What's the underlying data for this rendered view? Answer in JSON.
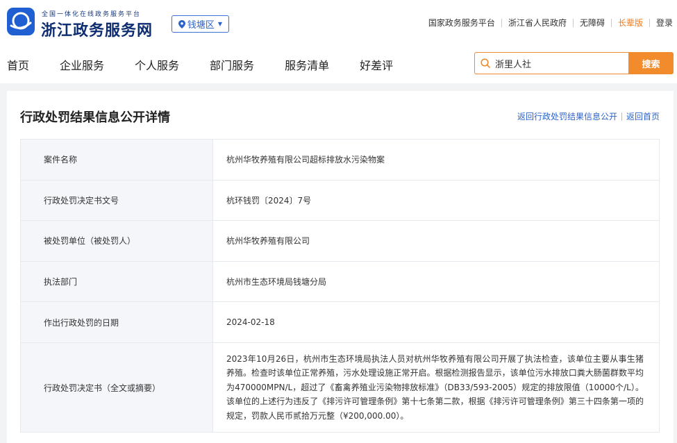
{
  "header": {
    "logo_tagline": "全国一体化在线政务服务平台",
    "logo_title": "浙江政务服务网",
    "region": "钱塘区",
    "top_links": [
      "国家政务服务平台",
      "浙江省人民政府",
      "无障碍",
      "长辈版",
      "登录"
    ]
  },
  "nav": {
    "items": [
      "首页",
      "企业服务",
      "个人服务",
      "部门服务",
      "服务清单",
      "好差评"
    ]
  },
  "search": {
    "value": "浙里人社",
    "button": "搜索"
  },
  "page": {
    "title": "行政处罚结果信息公开详情",
    "back_link": "返回行政处罚结果信息公开",
    "home_link": "返回首页"
  },
  "details": [
    {
      "label": "案件名称",
      "value": "杭州华牧养殖有限公司超标排放水污染物案"
    },
    {
      "label": "行政处罚决定书文号",
      "value": "杭环钱罚〔2024〕7号"
    },
    {
      "label": "被处罚单位（被处罚人）",
      "value": "杭州华牧养殖有限公司"
    },
    {
      "label": "执法部门",
      "value": "杭州市生态环境局钱塘分局"
    },
    {
      "label": "作出行政处罚的日期",
      "value": "2024-02-18"
    },
    {
      "label": "行政处罚决定书（全文或摘要）",
      "value": "2023年10月26日，杭州市生态环境局执法人员对杭州华牧养殖有限公司开展了执法检查，该单位主要从事生猪养殖。检查时该单位正常养殖，污水处理设施正常开启。根据检测报告显示，该单位污水排放口粪大肠菌群数平均为470000MPN/L，超过了《畜禽养殖业污染物排放标准》（DB33/593-2005）规定的排放限值（10000个/L）。该单位的上述行为违反了《排污许可管理条例》第十七条第二款，根据《排污许可管理条例》第三十四条第一项的规定，罚款人民币贰拾万元整（¥200,000.00）。"
    }
  ],
  "colors": {
    "brand_blue": "#0f2e72",
    "link_blue": "#2c63c9",
    "accent_orange": "#f28b2c"
  }
}
